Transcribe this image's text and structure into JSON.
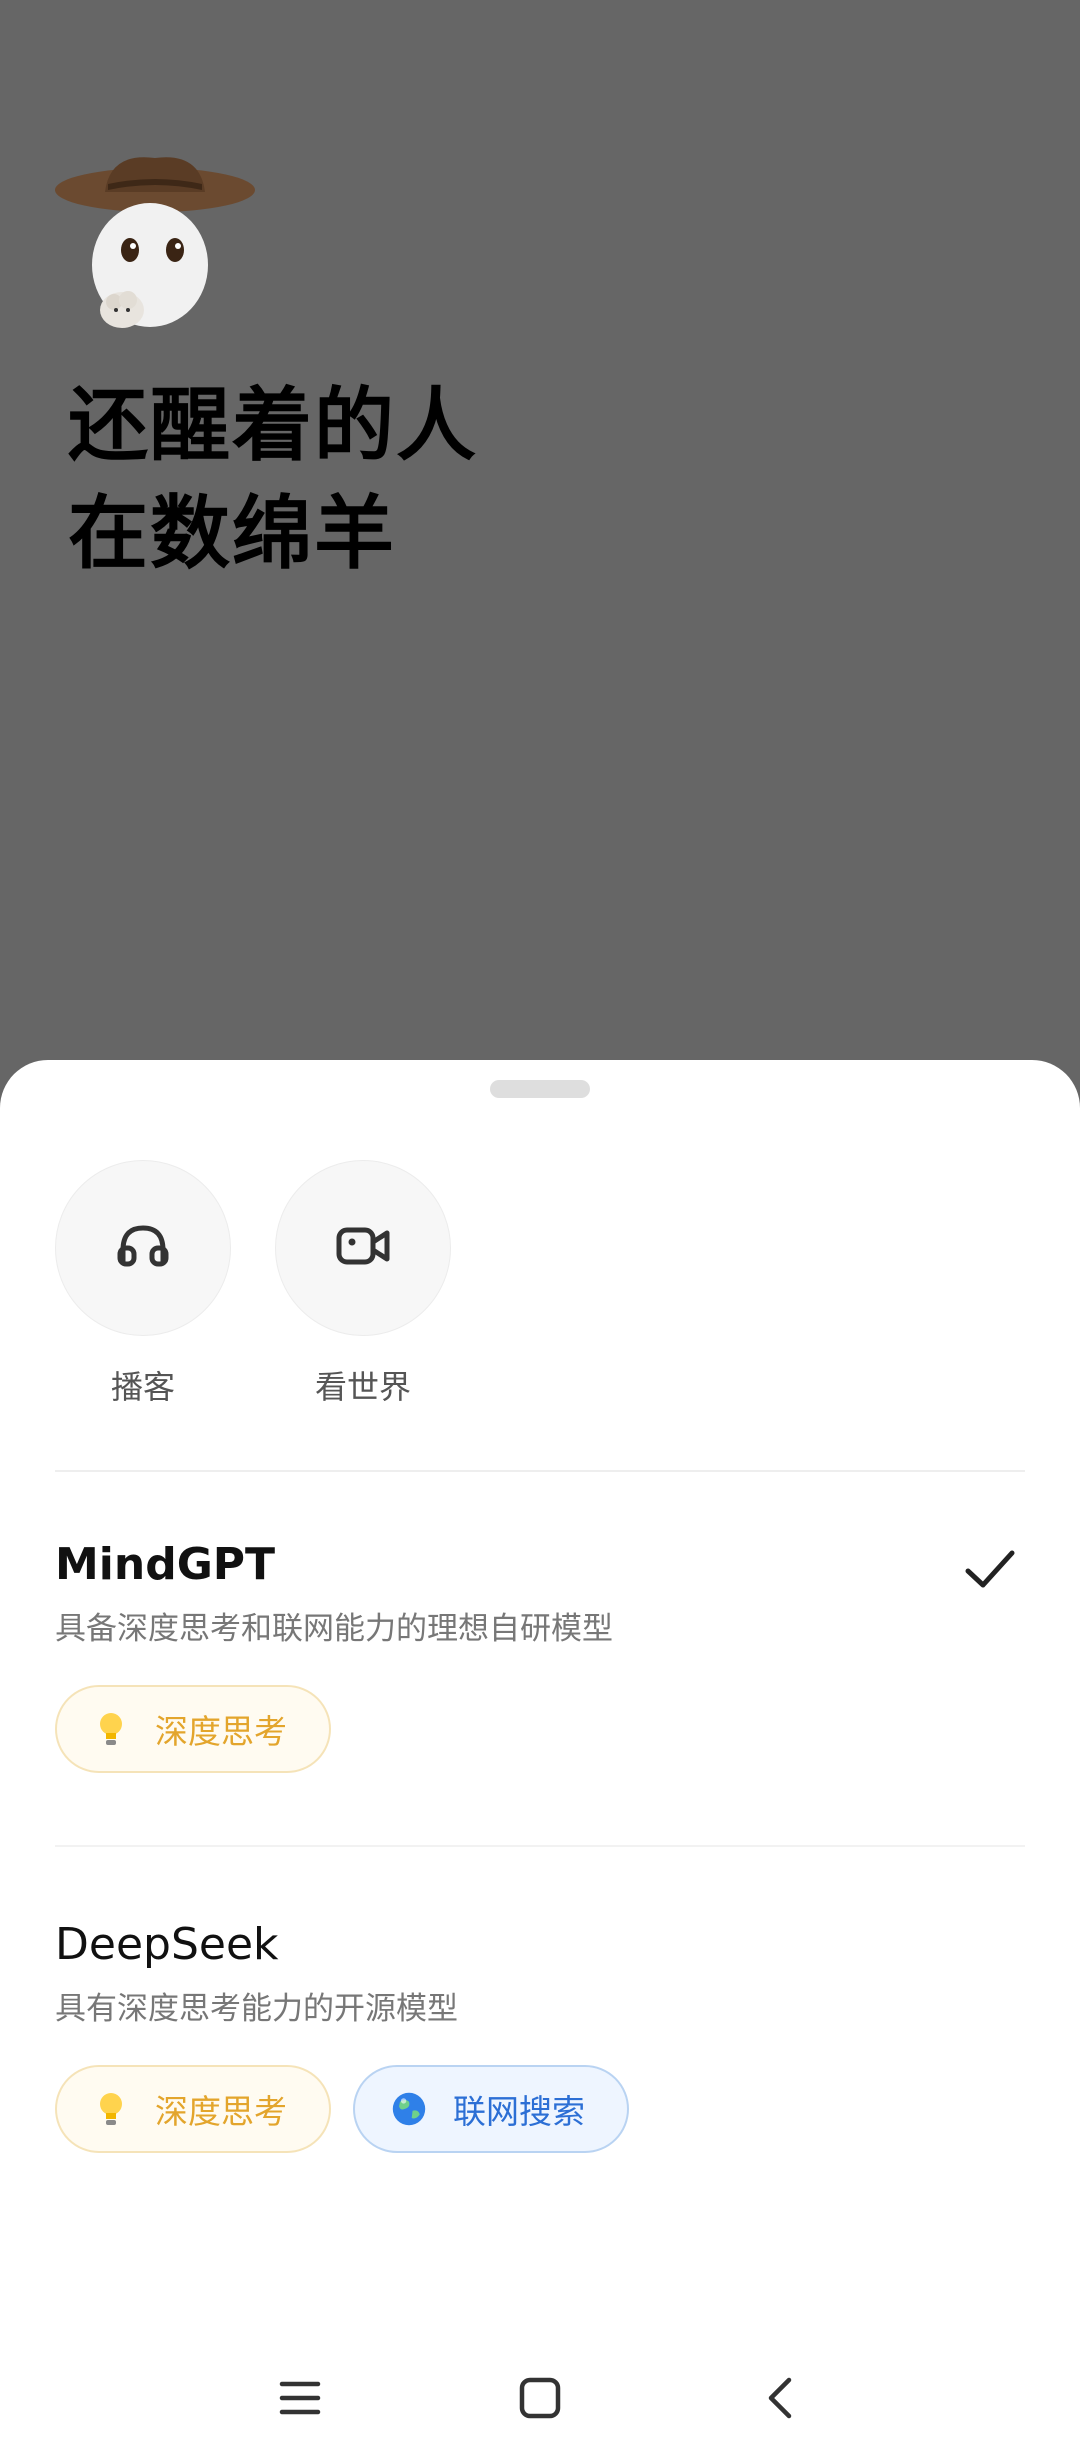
{
  "background": {
    "headline_line1": "还醒着的人",
    "headline_line2": "在数绵羊",
    "mascot_icon": "cowboy-mascot-sheep-sticker"
  },
  "sheet": {
    "quick_actions": [
      {
        "label": "播客",
        "icon": "podcast-icon"
      },
      {
        "label": "看世界",
        "icon": "video-camera-icon"
      }
    ],
    "models": [
      {
        "name": "MindGPT",
        "description": "具备深度思考和联网能力的理想自研模型",
        "selected": true,
        "tags": [
          {
            "label": "深度思考",
            "icon": "lightbulb-icon"
          }
        ]
      },
      {
        "name": "DeepSeek",
        "description": "具有深度思考能力的开源模型",
        "selected": false,
        "tags": [
          {
            "label": "深度思考",
            "icon": "lightbulb-icon"
          },
          {
            "label": "联网搜索",
            "icon": "globe-icon"
          }
        ]
      }
    ]
  },
  "colors": {
    "backdrop": "#666666",
    "think_tag_text": "#e3a52c",
    "search_tag_text": "#2c6fd5"
  },
  "navbar": {
    "buttons": [
      "menu-icon",
      "home-icon",
      "back-icon"
    ]
  }
}
